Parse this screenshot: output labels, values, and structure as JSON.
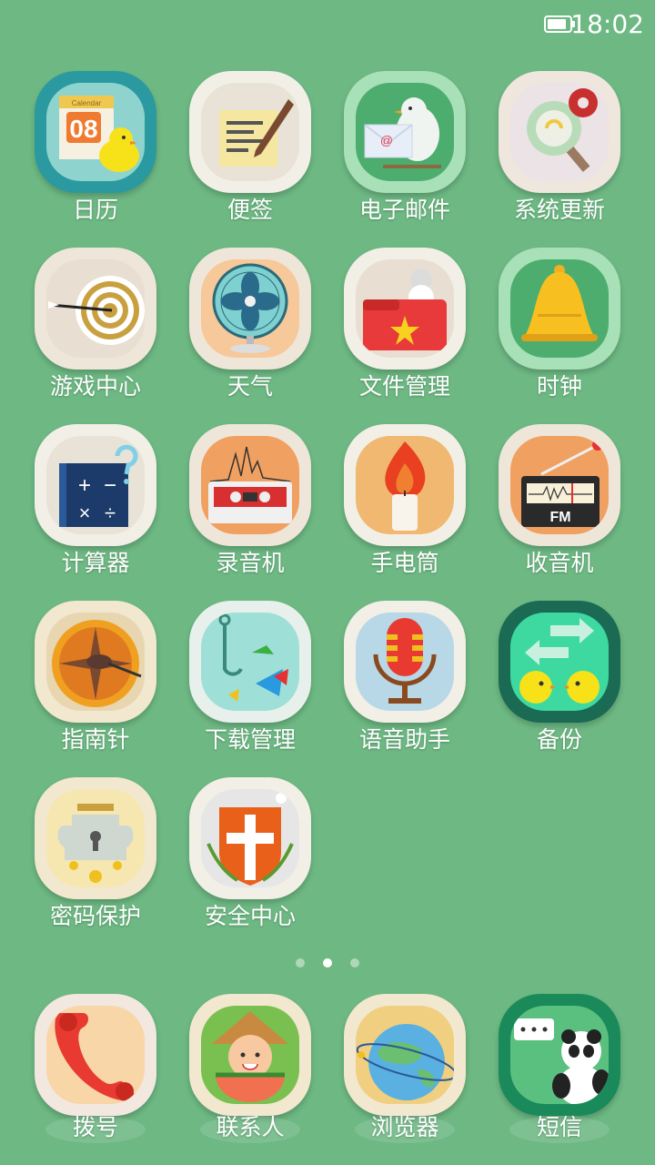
{
  "status_bar": {
    "time": "18:02",
    "battery_level": 0.85
  },
  "apps": [
    {
      "label": "日历",
      "icon": "calendar-icon",
      "calendar_header": "Calendar",
      "calendar_day": "08"
    },
    {
      "label": "便签",
      "icon": "notes-icon"
    },
    {
      "label": "电子邮件",
      "icon": "email-icon",
      "email_symbol": "@"
    },
    {
      "label": "系统更新",
      "icon": "system-update-icon"
    },
    {
      "label": "游戏中心",
      "icon": "game-center-icon"
    },
    {
      "label": "天气",
      "icon": "weather-icon"
    },
    {
      "label": "文件管理",
      "icon": "file-manager-icon"
    },
    {
      "label": "时钟",
      "icon": "clock-icon"
    },
    {
      "label": "计算器",
      "icon": "calculator-icon"
    },
    {
      "label": "录音机",
      "icon": "recorder-icon"
    },
    {
      "label": "手电筒",
      "icon": "flashlight-icon"
    },
    {
      "label": "收音机",
      "icon": "radio-icon",
      "radio_text": "FM"
    },
    {
      "label": "指南针",
      "icon": "compass-icon"
    },
    {
      "label": "下载管理",
      "icon": "download-manager-icon"
    },
    {
      "label": "语音助手",
      "icon": "voice-assistant-icon"
    },
    {
      "label": "备份",
      "icon": "backup-icon"
    },
    {
      "label": "密码保护",
      "icon": "password-protect-icon"
    },
    {
      "label": "安全中心",
      "icon": "security-center-icon"
    }
  ],
  "page_indicator": {
    "count": 3,
    "active_index": 1
  },
  "dock": [
    {
      "label": "拨号",
      "icon": "phone-icon"
    },
    {
      "label": "联系人",
      "icon": "contacts-icon"
    },
    {
      "label": "浏览器",
      "icon": "browser-icon"
    },
    {
      "label": "短信",
      "icon": "messages-icon"
    }
  ]
}
